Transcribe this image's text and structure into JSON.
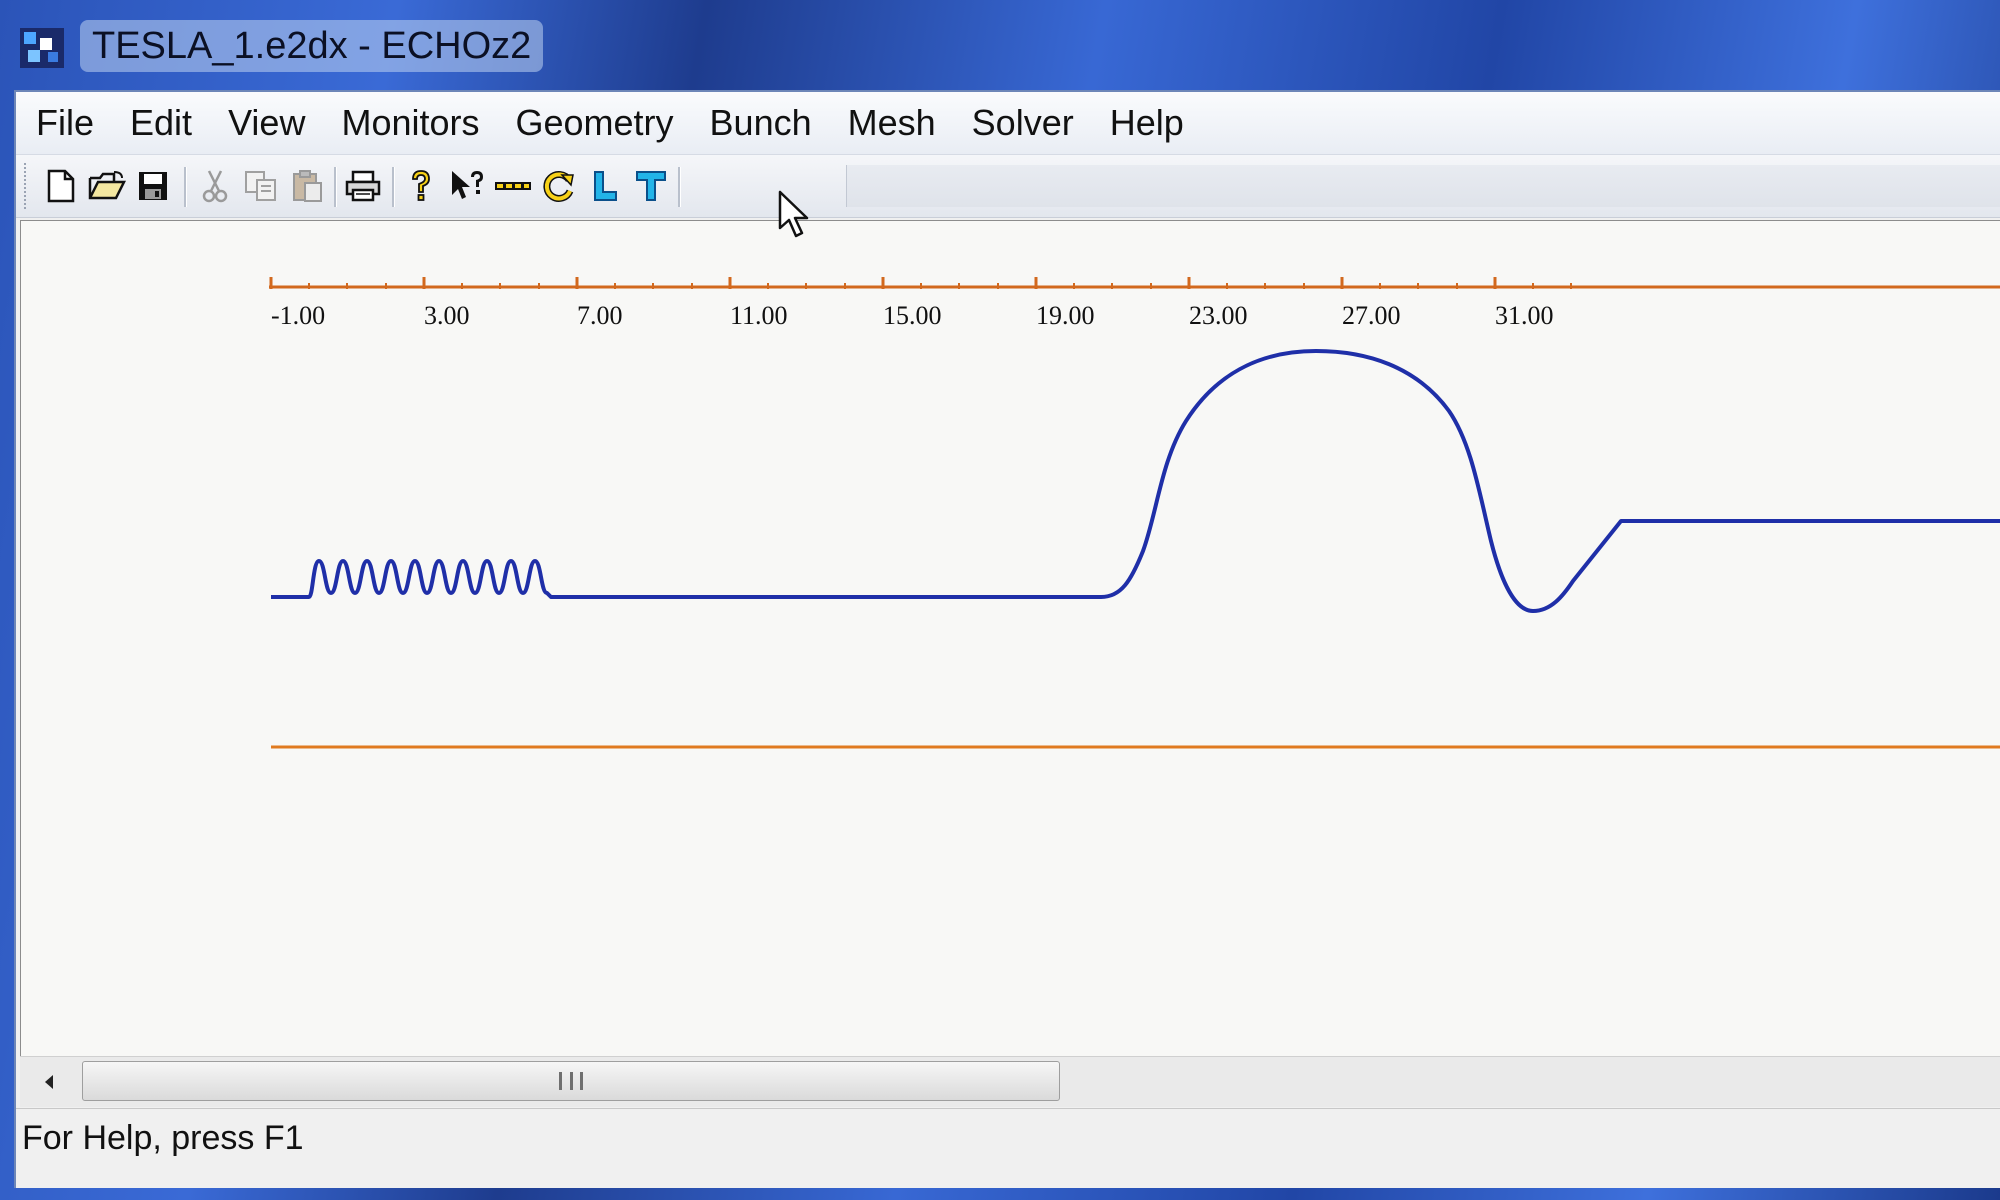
{
  "window": {
    "title": "TESLA_1.e2dx - ECHOz2"
  },
  "menubar": {
    "items": [
      {
        "label": "File"
      },
      {
        "label": "Edit"
      },
      {
        "label": "View"
      },
      {
        "label": "Monitors"
      },
      {
        "label": "Geometry"
      },
      {
        "label": "Bunch"
      },
      {
        "label": "Mesh"
      },
      {
        "label": "Solver"
      },
      {
        "label": "Help"
      }
    ]
  },
  "toolbar": {
    "buttons": [
      {
        "icon": "new-file-icon"
      },
      {
        "icon": "open-folder-icon"
      },
      {
        "icon": "save-icon"
      },
      {
        "icon": "cut-icon"
      },
      {
        "icon": "copy-icon"
      },
      {
        "icon": "paste-icon"
      },
      {
        "icon": "print-icon"
      },
      {
        "icon": "about-icon"
      },
      {
        "icon": "context-help-icon"
      },
      {
        "icon": "dashed-line-icon"
      },
      {
        "icon": "rotate-icon"
      },
      {
        "icon": "l-shape-icon"
      },
      {
        "icon": "t-shape-icon"
      }
    ]
  },
  "view": {
    "axis": {
      "tick_labels": [
        "-1.00",
        "3.00",
        "7.00",
        "11.00",
        "15.00",
        "19.00",
        "23.00",
        "27.00",
        "31.00"
      ],
      "color": "#d2691e"
    },
    "profile_color": "#1f2fa8",
    "baseline_color": "#e07a1f"
  },
  "statusbar": {
    "text": "For Help, press F1"
  },
  "colors": {
    "accent": "#1f2fa8",
    "axis": "#d2691e"
  }
}
